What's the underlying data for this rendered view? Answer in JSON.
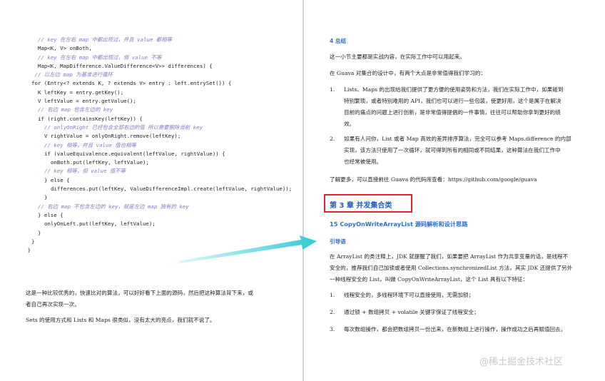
{
  "code_lines": [
    {
      "indent": 1,
      "text": "// key 在左右 map 中都出现过，并且 value 都相等",
      "cls": "cm"
    },
    {
      "indent": 1,
      "text": "Map<K, V> onBoth,",
      "cls": ""
    },
    {
      "indent": 1,
      "text": "// key 在左右 map 中都出现过，但 value 不等",
      "cls": "cm"
    },
    {
      "indent": 1,
      "text": "Map<K, MapDifference.ValueDifference<V>> differences) {",
      "cls": ""
    },
    {
      "indent": 0.5,
      "text": "// 以左边 map 为基准进行循环",
      "cls": "cm"
    },
    {
      "indent": 0,
      "text": "for (Entry<? extends K, ? extends V> entry : left.entrySet()) {",
      "cls": ""
    },
    {
      "indent": 1,
      "text": "K leftKey = entry.getKey();",
      "cls": ""
    },
    {
      "indent": 1,
      "text": "V leftValue = entry.getValue();",
      "cls": ""
    },
    {
      "indent": 1,
      "text": "// 右边 map 包含左边的 key",
      "cls": "cm"
    },
    {
      "indent": 1,
      "text": "if (right.containsKey(leftKey)) {",
      "cls": ""
    },
    {
      "indent": 2,
      "text": "// onlyOnRight 已经包含全部右边的值 所以需要删除当前 key",
      "cls": "cm"
    },
    {
      "indent": 2,
      "text": "V rightValue = onlyOnRight.remove(leftKey);",
      "cls": ""
    },
    {
      "indent": 2,
      "text": "// key 相等，并且 value 值也相等",
      "cls": "cm"
    },
    {
      "indent": 2,
      "text": "if (valueEquivalence.equivalent(leftValue, rightValue)) {",
      "cls": ""
    },
    {
      "indent": 3,
      "text": "onBoth.put(leftKey, leftValue);",
      "cls": ""
    },
    {
      "indent": 2,
      "text": "// key 相等，但 value 值不等",
      "cls": "cm"
    },
    {
      "indent": 2,
      "text": "} else {",
      "cls": ""
    },
    {
      "indent": 3,
      "text": "differences.put(leftKey, ValueDifferenceImpl.create(leftValue, rightValue));",
      "cls": ""
    },
    {
      "indent": 2,
      "text": "}",
      "cls": ""
    },
    {
      "indent": 1,
      "text": "// 右边 map 不包含左边的 key，就是左边 map 独有的 key",
      "cls": "cm"
    },
    {
      "indent": 1,
      "text": "} else {",
      "cls": ""
    },
    {
      "indent": 2,
      "text": "onlyOnLeft.put(leftKey, leftValue);",
      "cls": ""
    },
    {
      "indent": 1,
      "text": "}",
      "cls": ""
    },
    {
      "indent": 0,
      "text": "}",
      "cls": ""
    },
    {
      "indent": -0.6,
      "text": "}",
      "cls": ""
    }
  ],
  "left_text": {
    "para1_line1": "这是一种比较优秀的，快速比对的算法，可以好好看下上面的源码，然后把这种算法背下来，或",
    "para1_line2": "者自己再次实现一次。",
    "para2": "Sets 的使用方式和 Lists 和 Maps 很类似，没有太大的亮点，我们就不说了。"
  },
  "right_text": {
    "summary_heading": "4 总结",
    "summary_p1": "这一小节主要都是实战内容，在实际工作中可以用起来。",
    "summary_p2": "在 Guava 对集合的设计中，有两个大点是非常值得我们学习的：",
    "list1": [
      {
        "num": "1.",
        "lines": [
          "Lists、Maps 的出现给我们提供了更方便的使用姿势和方法，我们在实际工作中，如果碰到",
          "特别繁琐，或者特别难用的 API，我们也可以进行一些包装，使更好用，这个是属于在解决",
          "目前的痛点的问题上进行创新，是非常值得提倡的一件事情，往往可以帮助你拿到更好的绩",
          "效。"
        ]
      },
      {
        "num": "2.",
        "lines": [
          "如果有人问你，List 或者 Map 高效的差异排序算法，完全可以参考 Maps.difference 的内部",
          "实现，该方法只使用了一次循环，就可得到所有的相同或不同结果，这种算法在我们工作中",
          "也经常被使用。"
        ]
      }
    ],
    "more_info": "了解更多，可以直接前往 Guava 的代码库查看：https://github.com/google/guava",
    "chapter_title": "第 3 章 并发集合类",
    "section_title": "15 CopyOnWriteArrayList 源码解析和设计思路",
    "intro_heading": "引导语",
    "intro_p": [
      "在 ArrayList 的类注释上，JDK 就提醒了我们，如果要把 ArrayList 作为共享变量的话，是线程不",
      "安全的，推荐我们自己加锁或者使用 Collections.synchronizedList 方法，其实 JDK 还提供了另外",
      "一种线程安全的 List，叫做 CopyOnWriteArrayList，这个 List 具有以下特征："
    ],
    "list2": [
      {
        "num": "1.",
        "text": "线程安全的，多线程环境下可以直接使用，无需加锁；"
      },
      {
        "num": "2.",
        "text": "通过锁 + 数组拷贝 + volatile 关键字保证了线程安全；"
      },
      {
        "num": "3.",
        "text": "每次数组操作，都会把数组拷贝一份出来，在新数组上进行操作，操作成功之后再赋值回去。"
      }
    ],
    "watermark": "@稀土掘金技术社区"
  },
  "colors": {
    "highlight_box": "#e3202b",
    "arrow": "#33c9d6",
    "heading_blue": "#2a6fcf"
  }
}
